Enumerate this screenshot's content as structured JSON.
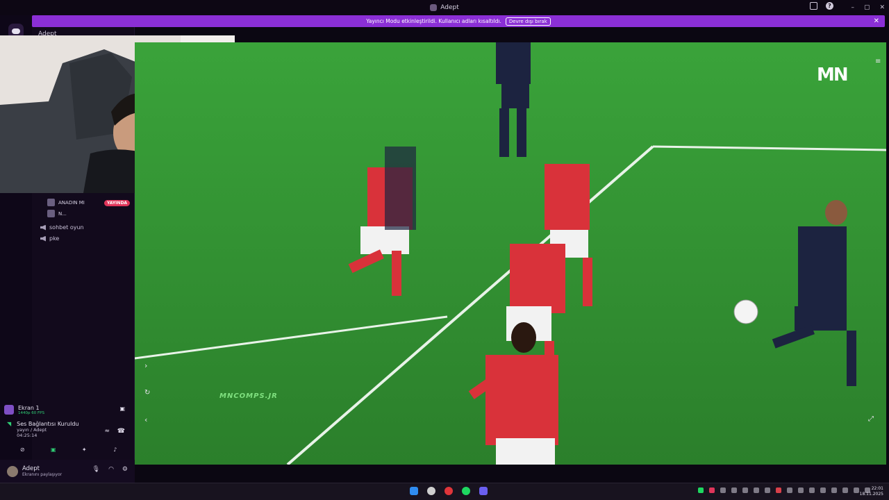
{
  "window": {
    "title": "Adept"
  },
  "banner": {
    "text": "Yayıncı Modu etkinleştirildi. Kullanıcı adları kısaltıldı.",
    "button": "Devre dışı bırak"
  },
  "channels": {
    "top_label": "Adept",
    "voice_users": [
      {
        "name": "ANADIN MI",
        "badge": "YAYINDA"
      },
      {
        "name": "N..."
      }
    ],
    "voice_channels": [
      "sohbet oyun",
      "pke"
    ]
  },
  "screen_share": {
    "title": "Ekran 1",
    "quality": "1440p 60 FPS"
  },
  "voice_connection": {
    "status": "Ses Bağlantısı Kuruldu",
    "channel": "yayın / Adept",
    "time": "04:25:14"
  },
  "user": {
    "name": "Adept",
    "status": "Ekranını paylaşıyor"
  },
  "stream": {
    "watermark": "MNCOMPS.JR",
    "logo": "MN"
  },
  "taskbar": {
    "time": "22:01",
    "date": "18.11.2025"
  },
  "colors": {
    "banner": "#8b2fd6",
    "live": "#e0355a",
    "pitch": "#2f8a2d",
    "status_green": "#2fcf75"
  }
}
